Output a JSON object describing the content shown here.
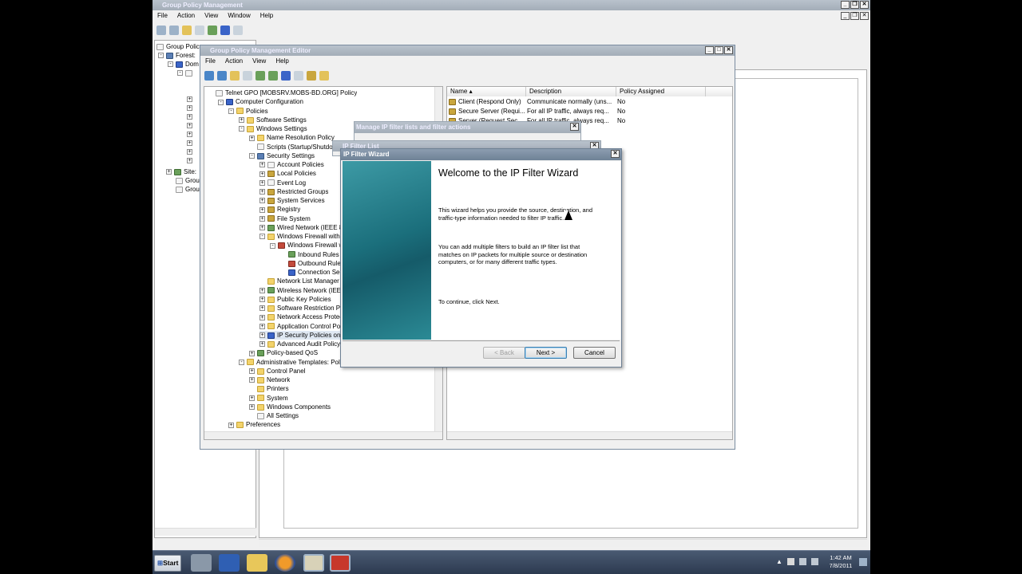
{
  "gpm": {
    "title": "Group Policy Management",
    "menu": [
      "File",
      "Action",
      "View",
      "Window",
      "Help"
    ],
    "tree_items": [
      "Group Policy",
      "Forest:",
      "Dom",
      "Site:",
      "Grou",
      "Grou"
    ]
  },
  "gpme": {
    "title": "Group Policy Management Editor",
    "menu": [
      "File",
      "Action",
      "View",
      "Help"
    ],
    "tree": [
      {
        "label": "Telnet GPO [MOBSRV.MOBS-BD.ORG] Policy",
        "indent": 0,
        "icon": "doc",
        "tog": ""
      },
      {
        "label": "Computer Configuration",
        "indent": 1,
        "icon": "blue",
        "tog": "-"
      },
      {
        "label": "Policies",
        "indent": 2,
        "icon": "folder",
        "tog": "-"
      },
      {
        "label": "Software Settings",
        "indent": 3,
        "icon": "folder",
        "tog": "+"
      },
      {
        "label": "Windows Settings",
        "indent": 3,
        "icon": "folder",
        "tog": "-"
      },
      {
        "label": "Name Resolution Policy",
        "indent": 4,
        "icon": "folder",
        "tog": "+"
      },
      {
        "label": "Scripts (Startup/Shutdown)",
        "indent": 4,
        "icon": "doc",
        "tog": ""
      },
      {
        "label": "Security Settings",
        "indent": 4,
        "icon": "shield",
        "tog": "-"
      },
      {
        "label": "Account Policies",
        "indent": 5,
        "icon": "doc",
        "tog": "+"
      },
      {
        "label": "Local Policies",
        "indent": 5,
        "icon": "lock",
        "tog": "+"
      },
      {
        "label": "Event Log",
        "indent": 5,
        "icon": "doc",
        "tog": "+"
      },
      {
        "label": "Restricted Groups",
        "indent": 5,
        "icon": "lock",
        "tog": "+"
      },
      {
        "label": "System Services",
        "indent": 5,
        "icon": "lock",
        "tog": "+"
      },
      {
        "label": "Registry",
        "indent": 5,
        "icon": "lock",
        "tog": "+"
      },
      {
        "label": "File System",
        "indent": 5,
        "icon": "lock",
        "tog": "+"
      },
      {
        "label": "Wired Network (IEEE 80",
        "indent": 5,
        "icon": "net",
        "tog": "+"
      },
      {
        "label": "Windows Firewall with A",
        "indent": 5,
        "icon": "folder",
        "tog": "-"
      },
      {
        "label": "Windows Firewall w",
        "indent": 6,
        "icon": "red",
        "tog": "-"
      },
      {
        "label": "Inbound Rules",
        "indent": 7,
        "icon": "net",
        "tog": ""
      },
      {
        "label": "Outbound Rules",
        "indent": 7,
        "icon": "red",
        "tog": ""
      },
      {
        "label": "Connection Sec",
        "indent": 7,
        "icon": "blue",
        "tog": ""
      },
      {
        "label": "Network List Manager P",
        "indent": 5,
        "icon": "folder",
        "tog": ""
      },
      {
        "label": "Wireless Network (IEEE",
        "indent": 5,
        "icon": "net",
        "tog": "+"
      },
      {
        "label": "Public Key Policies",
        "indent": 5,
        "icon": "folder",
        "tog": "+"
      },
      {
        "label": "Software Restriction Po",
        "indent": 5,
        "icon": "folder",
        "tog": "+"
      },
      {
        "label": "Network Access Protect",
        "indent": 5,
        "icon": "folder",
        "tog": "+"
      },
      {
        "label": "Application Control Poli",
        "indent": 5,
        "icon": "folder",
        "tog": "+"
      },
      {
        "label": "IP Security Policies on A",
        "indent": 5,
        "icon": "blue",
        "tog": "+"
      },
      {
        "label": "Advanced Audit Policy C",
        "indent": 5,
        "icon": "folder",
        "tog": "+"
      },
      {
        "label": "Policy-based QoS",
        "indent": 4,
        "icon": "net",
        "tog": "+"
      },
      {
        "label": "Administrative Templates: Policy de",
        "indent": 3,
        "icon": "folder",
        "tog": "-"
      },
      {
        "label": "Control Panel",
        "indent": 4,
        "icon": "folder",
        "tog": "+"
      },
      {
        "label": "Network",
        "indent": 4,
        "icon": "folder",
        "tog": "+"
      },
      {
        "label": "Printers",
        "indent": 4,
        "icon": "folder",
        "tog": ""
      },
      {
        "label": "System",
        "indent": 4,
        "icon": "folder",
        "tog": "+"
      },
      {
        "label": "Windows Components",
        "indent": 4,
        "icon": "folder",
        "tog": "+"
      },
      {
        "label": "All Settings",
        "indent": 4,
        "icon": "doc",
        "tog": ""
      },
      {
        "label": "Preferences",
        "indent": 2,
        "icon": "folder",
        "tog": "+"
      }
    ],
    "columns": [
      "Name",
      "Description",
      "Policy Assigned"
    ],
    "rows": [
      {
        "name": "Client (Respond Only)",
        "desc": "Communicate normally (uns...",
        "assigned": "No"
      },
      {
        "name": "Secure Server (Requi...",
        "desc": "For all IP traffic, always req...",
        "assigned": "No"
      },
      {
        "name": "Server (Request Sec...",
        "desc": "For all IP traffic, always req...",
        "assigned": "No"
      }
    ]
  },
  "manage_dialog": {
    "title": "Manage IP filter lists and filter actions"
  },
  "filter_list_dialog": {
    "title": "IP Filter List"
  },
  "wizard": {
    "title": "IP Filter Wizard",
    "heading": "Welcome to the IP Filter Wizard",
    "para1": "This wizard helps you provide the source, destination, and traffic-type information needed to filter IP traffic.",
    "para2": "You can add multiple filters to build an IP filter list that matches on IP packets for multiple source or destination computers, or for many different traffic types.",
    "para3": "To continue, click Next.",
    "back_label": "< Back",
    "next_label": "Next >",
    "cancel_label": "Cancel"
  },
  "taskbar": {
    "start_label": "Start",
    "time": "1:42 AM",
    "date": "7/8/2011"
  },
  "colors": {
    "title_active": "#7a8ca0",
    "wizard_side": "#1f7a86"
  }
}
